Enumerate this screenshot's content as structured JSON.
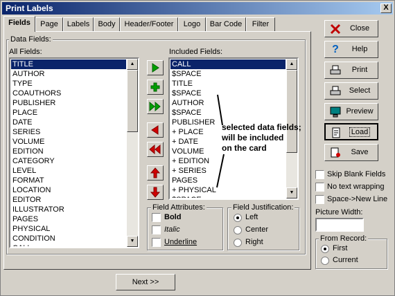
{
  "window": {
    "title": "Print Labels",
    "close_glyph": "X"
  },
  "tabs": [
    "Fields",
    "Page",
    "Labels",
    "Body",
    "Header/Footer",
    "Logo",
    "Bar Code",
    "Filter"
  ],
  "data_fields": {
    "group_label": "Data Fields:",
    "all_label": "All Fields:",
    "all_items": [
      "TITLE",
      "AUTHOR",
      "TYPE",
      "COAUTHORS",
      "PUBLISHER",
      "PLACE",
      "DATE",
      "SERIES",
      "VOLUME",
      "EDITION",
      "CATEGORY",
      "LEVEL",
      "FORMAT",
      "LOCATION",
      "EDITOR",
      "ILLUSTRATOR",
      "PAGES",
      "PHYSICAL",
      "CONDITION",
      "CALL"
    ],
    "included_label": "Included Fields:",
    "included_items": [
      "CALL",
      "$SPACE",
      "TITLE",
      "$SPACE",
      "AUTHOR",
      "$SPACE",
      "PUBLISHER",
      "+ PLACE",
      "+ DATE",
      "VOLUME",
      "+ EDITION",
      "+ SERIES",
      "PAGES",
      "+ PHYSICAL",
      "$SPACE"
    ]
  },
  "annotation": {
    "line1": "selected data fields;",
    "line2": "will be included",
    "line3": "on the card"
  },
  "field_attributes": {
    "label": "Field Attributes:",
    "bold": "Bold",
    "italic": "Italic",
    "underline": "Underline"
  },
  "field_justification": {
    "label": "Field Justification:",
    "left": "Left",
    "center": "Center",
    "right": "Right",
    "selected": "Left"
  },
  "buttons": {
    "close": "Close",
    "help": "Help",
    "print": "Print",
    "select": "Select",
    "preview": "Preview",
    "load": "Load",
    "save": "Save",
    "next": "Next >>"
  },
  "options": {
    "skip_blank": "Skip Blank Fields",
    "no_wrap": "No text wrapping",
    "space_newline": "Space->New Line"
  },
  "picture_width": {
    "label": "Picture Width:",
    "value": ""
  },
  "from_record": {
    "label": "From Record:",
    "first": "First",
    "current": "Current",
    "selected": "First"
  },
  "colors": {
    "selection": "#0a246a",
    "arrow_green": "#00a000",
    "arrow_red": "#d00000"
  }
}
